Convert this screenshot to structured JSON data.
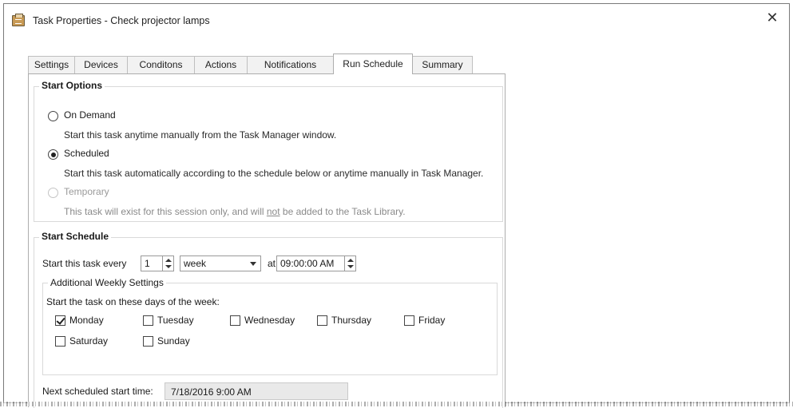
{
  "window": {
    "title": "Task Properties - Check projector lamps",
    "close_symbol": "✕"
  },
  "tabs": [
    {
      "label": "Settings",
      "active": false
    },
    {
      "label": "Devices",
      "active": false
    },
    {
      "label": "Conditons",
      "active": false
    },
    {
      "label": "Actions",
      "active": false
    },
    {
      "label": "Notifications",
      "active": false
    },
    {
      "label": "Run Schedule",
      "active": true
    },
    {
      "label": "Summary",
      "active": false
    }
  ],
  "start_options": {
    "title": "Start Options",
    "on_demand": {
      "label": "On Demand",
      "description": "Start this task anytime manually from the Task Manager window.",
      "checked": false
    },
    "scheduled": {
      "label": "Scheduled",
      "description": "Start this task automatically according to the schedule below or anytime manually in Task Manager.",
      "checked": true
    },
    "temporary": {
      "label": "Temporary",
      "description_before": "This task will exist for this session only, and will ",
      "description_emphasis": "not",
      "description_after": " be added to the Task Library.",
      "checked": false,
      "disabled": true
    }
  },
  "start_schedule": {
    "title": "Start Schedule",
    "every_label": "Start this task every",
    "interval_value": "1",
    "unit_value": "week",
    "at_label": "at",
    "time_value": "09:00:00 AM",
    "weekly": {
      "title": "Additional Weekly Settings",
      "prompt": "Start the task on these days of the week:",
      "days": [
        {
          "label": "Monday",
          "checked": true
        },
        {
          "label": "Tuesday",
          "checked": false
        },
        {
          "label": "Wednesday",
          "checked": false
        },
        {
          "label": "Thursday",
          "checked": false
        },
        {
          "label": "Friday",
          "checked": false
        },
        {
          "label": "Saturday",
          "checked": false
        },
        {
          "label": "Sunday",
          "checked": false
        }
      ]
    },
    "next_label": "Next scheduled start time:",
    "next_value": "7/18/2016 9:00 AM"
  }
}
